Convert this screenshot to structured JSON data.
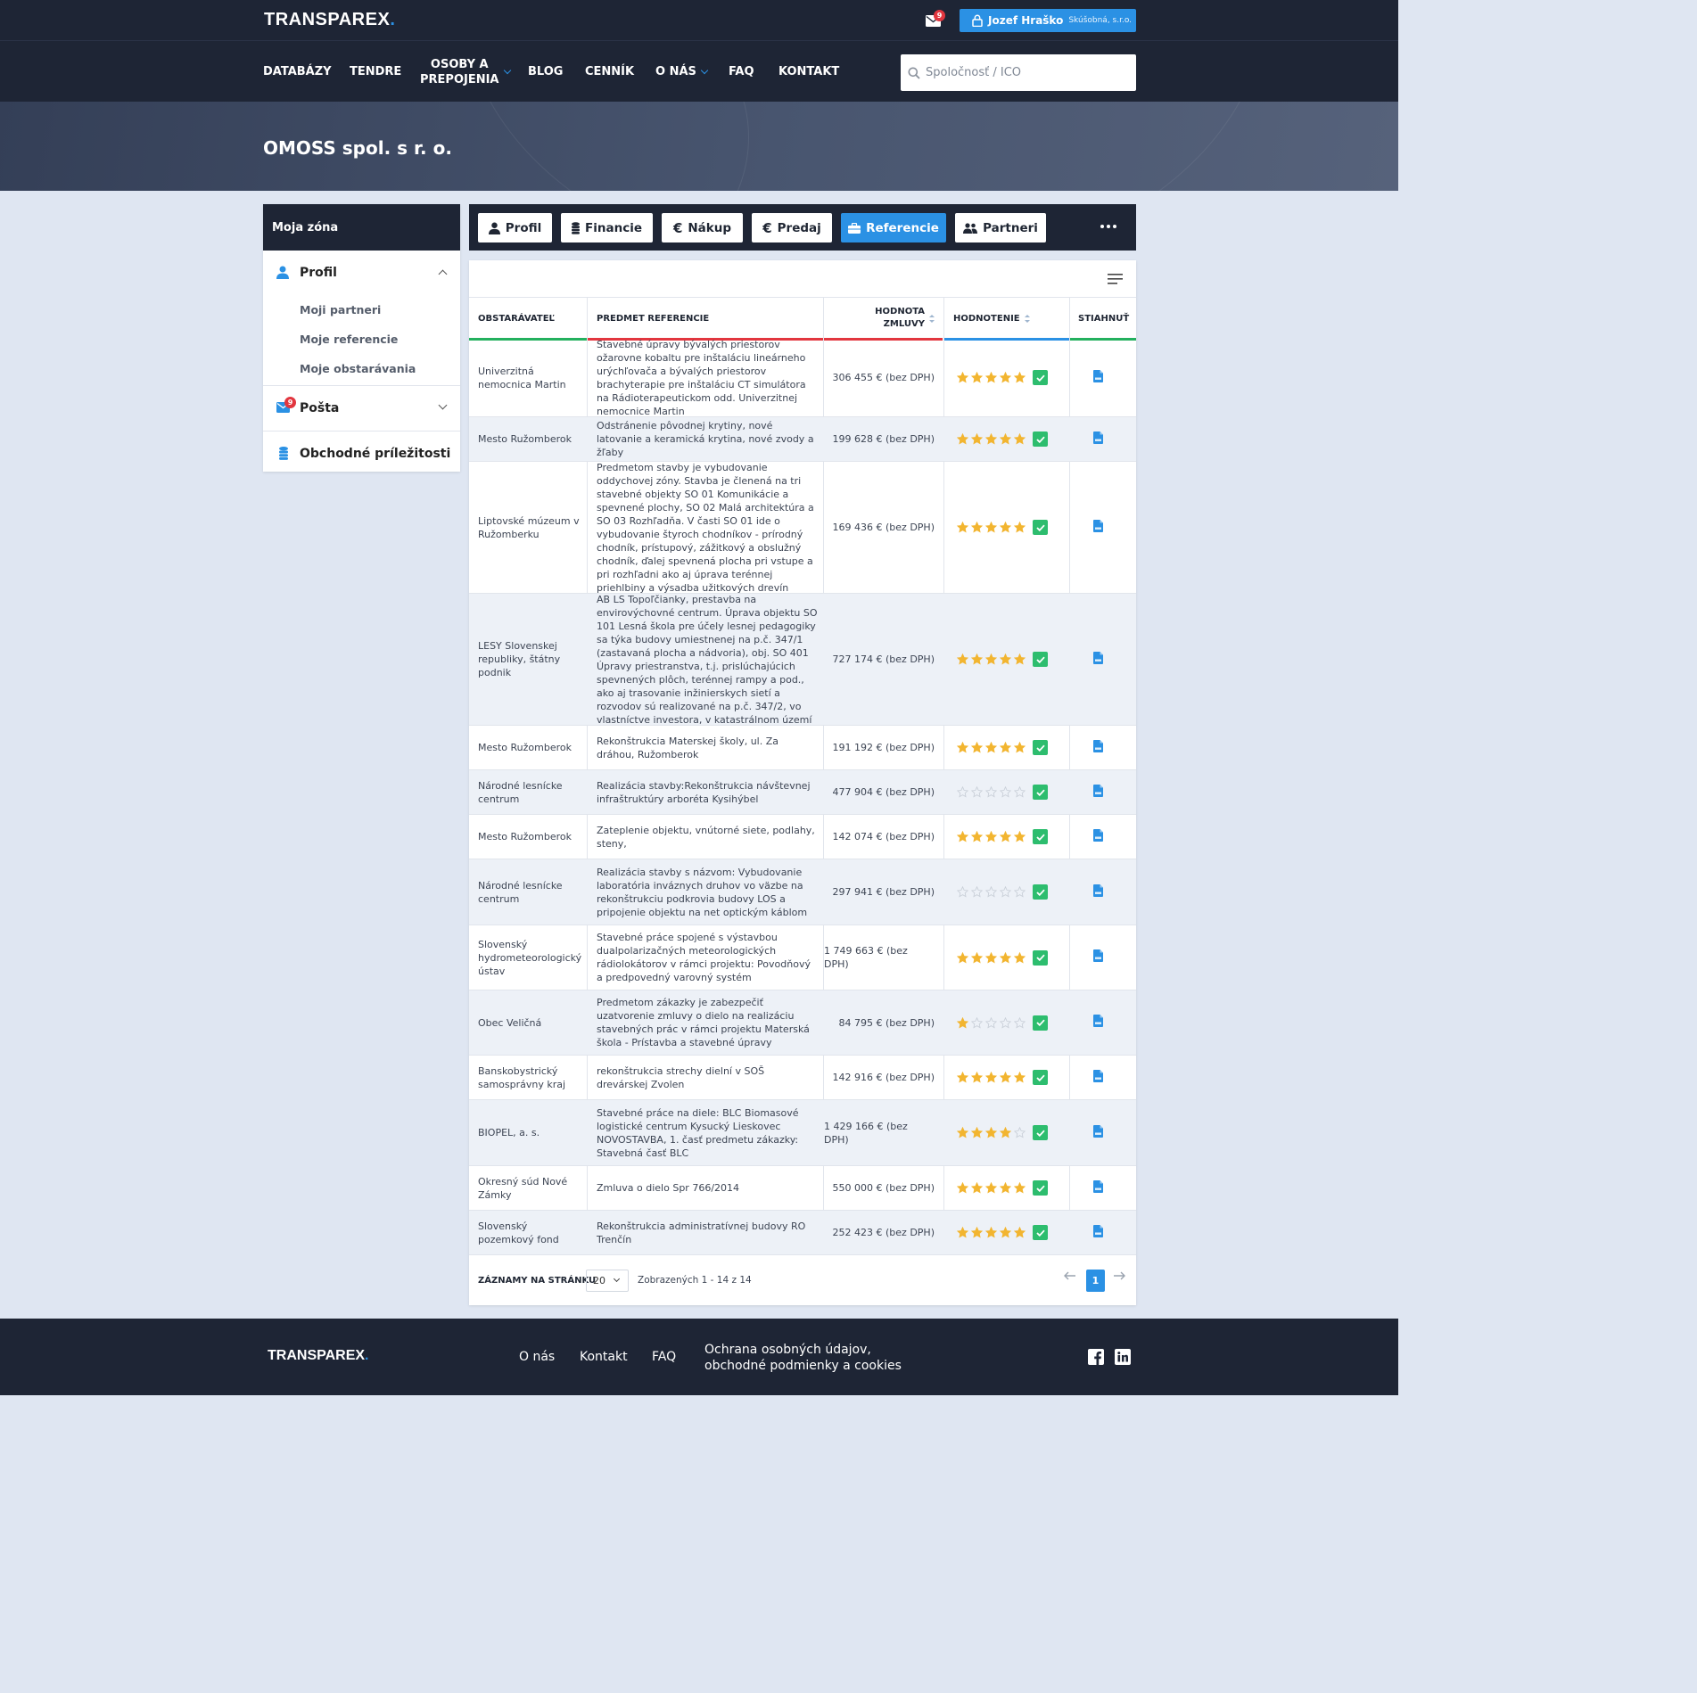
{
  "header": {
    "logo": "TRANSPAREX",
    "logo_dot": ".",
    "mail_badge": "9",
    "user_name": "Jozef Hraško",
    "user_org": "Skúšobná, s.r.o."
  },
  "nav": {
    "items": [
      "DATABÁZY",
      "TENDRE",
      "OSOBY A",
      "PREPOJENIA",
      "BLOG",
      "CENNÍK",
      "O NÁS",
      "FAQ",
      "KONTAKT"
    ],
    "search_placeholder": "Spoločnosť / IČO"
  },
  "hero": {
    "title": "OMOSS spol. s r. o."
  },
  "sidebar": {
    "title": "Moja zóna",
    "profile_label": "Profil",
    "sub_items": [
      "Moji partneri",
      "Moje referencie",
      "Moje obstarávania"
    ],
    "mail_label": "Pošta",
    "mail_badge": "9",
    "opportunities_label": "Obchodné príležitosti"
  },
  "tabs": [
    {
      "label": "Profil",
      "icon": "user-icon",
      "active": false
    },
    {
      "label": "Financie",
      "icon": "coins-icon",
      "active": false
    },
    {
      "label": "Nákup",
      "icon": "euro-icon",
      "active": false
    },
    {
      "label": "Predaj",
      "icon": "euro-icon",
      "active": false
    },
    {
      "label": "Referencie",
      "icon": "briefcase-icon",
      "active": true
    },
    {
      "label": "Partneri",
      "icon": "users-icon",
      "active": false
    }
  ],
  "table": {
    "headers": {
      "contracting": "OBSTARÁVATEĽ",
      "subject": "PREDMET REFERENCIE",
      "value_l1": "HODNOTA",
      "value_l2": "ZMLUVY",
      "rating": "HODNOTENIE",
      "download": "STIAHNUŤ"
    },
    "colors": {
      "green": "#23b05e",
      "red": "#e2363f",
      "blue": "#2b91e4",
      "star": "#f2b530",
      "star_empty": "#c9cfd8"
    },
    "rows": [
      {
        "org": "Univerzitná nemocnica Martin",
        "subject": "Stavebné úpravy bývalých priestorov ožarovne kobaltu pre inštaláciu lineárneho urýchľovača a bývalých priestorov brachyterapie pre inštaláciu CT simulátora na Rádioterapeutickom odd. Univerzitnej nemocnice Martin",
        "value": "306 455 € (bez DPH)",
        "stars": 5
      },
      {
        "org": "Mesto Ružomberok",
        "subject": "Odstránenie pôvodnej krytiny, nové latovanie a keramická krytina, nové zvody a žľaby",
        "value": "199 628 € (bez DPH)",
        "stars": 5
      },
      {
        "org": "Liptovské múzeum v Ružomberku",
        "subject": "Predmetom stavby je vybudovanie oddychovej zóny. Stavba je členená na tri stavebné objekty SO 01 Komunikácie a spevnené plochy, SO 02 Malá architektúra a SO 03 Rozhľadňa. V časti SO 01 ide o vybudovanie štyroch chodníkov - prírodný chodník, prístupový, zážitkový a obslužný chodník, ďalej spevnená plocha pri vstupe a pri rozhľadni ako aj úprava terénnej priehlbiny a výsadba užitkových drevín",
        "value": "169 436 € (bez DPH)",
        "stars": 5
      },
      {
        "org": "LESY Slovenskej republiky, štátny podnik",
        "subject": "AB LS Topoľčianky, prestavba na envirovýchovné centrum. Úprava objektu SO 101 Lesná škola pre účely lesnej pedagogiky sa týka budovy umiestnenej na p.č. 347/1 (zastavaná plocha a nádvoria), obj. SO 401 Úpravy priestranstva, t.j. prislúchajúcich spevnených plôch, terénnej rampy a pod., ako aj trasovanie inžinierskych sietí a rozvodov sú realizované na p.č. 347/2, vo vlastníctve investora, v katastrálnom území",
        "value": "727 174 € (bez DPH)",
        "stars": 5
      },
      {
        "org": "Mesto Ružomberok",
        "subject": "Rekonštrukcia Materskej školy, ul. Za dráhou, Ružomberok",
        "value": "191 192 € (bez DPH)",
        "stars": 5
      },
      {
        "org": "Národné lesnícke centrum",
        "subject": "Realizácia stavby:Rekonštrukcia návštevnej infraštruktúry arboréta Kysihýbel",
        "value": "477 904 € (bez DPH)",
        "stars": 0
      },
      {
        "org": "Mesto Ružomberok",
        "subject": "Zateplenie objektu, vnútorné siete, podlahy, steny,",
        "value": "142 074 € (bez DPH)",
        "stars": 5
      },
      {
        "org": "Národné lesnícke centrum",
        "subject": "Realizácia stavby s názvom: Vybudovanie laboratória inváznych druhov vo väzbe na rekonštrukciu podkrovia budovy LOS a pripojenie objektu na net optickým káblom",
        "value": "297 941 € (bez DPH)",
        "stars": 0
      },
      {
        "org": "Slovenský hydrometeorologický ústav",
        "subject": "Stavebné práce spojené s výstavbou dualpolarizačných meteorologických rádiolokátorov v rámci projektu: Povodňový a predpovedný varovný systém",
        "value": "1 749 663 € (bez DPH)",
        "stars": 5
      },
      {
        "org": "Obec Veličná",
        "subject": "Predmetom zákazky je zabezpečiť uzatvorenie zmluvy o dielo na realizáciu stavebných prác v rámci projektu Materská škola - Prístavba a stavebné úpravy",
        "value": "84 795 € (bez DPH)",
        "stars": 1
      },
      {
        "org": "Banskobystrický samosprávny kraj",
        "subject": "rekonštrukcia strechy dielní v SOŠ drevárskej Zvolen",
        "value": "142 916 € (bez DPH)",
        "stars": 5
      },
      {
        "org": "BIOPEL, a. s.",
        "subject": "Stavebné práce na diele: BLC Biomasové logistické centrum Kysucký Lieskovec NOVOSTAVBA, 1. časť predmetu zákazky: Stavebná časť BLC",
        "value": "1 429 166 € (bez DPH)",
        "stars": 4
      },
      {
        "org": "Okresný súd Nové Zámky",
        "subject": "Zmluva o dielo Spr 766/2014",
        "value": "550 000 € (bez DPH)",
        "stars": 5
      },
      {
        "org": "Slovenský pozemkový fond",
        "subject": "Rekonštrukcia administratívnej budovy RO Trenčín",
        "value": "252 423 € (bez DPH)",
        "stars": 5
      }
    ],
    "footer": {
      "per_page_label": "ZÁZNAMY NA STRÁNKU",
      "per_page_value": "20",
      "shown_text": "Zobrazených 1 - 14 z 14",
      "current_page": "1"
    }
  },
  "footer": {
    "logo": "TRANSPAREX",
    "logo_dot": ".",
    "links": [
      "O nás",
      "Kontakt",
      "FAQ"
    ],
    "privacy_l1": "Ochrana osobných údajov,",
    "privacy_l2": "obchodné podmienky a cookies"
  }
}
